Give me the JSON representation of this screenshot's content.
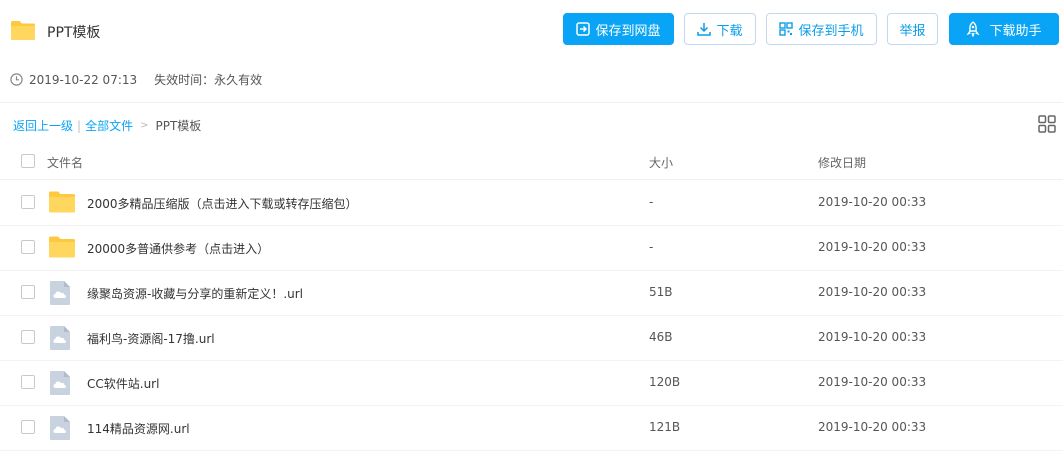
{
  "header": {
    "title": "PPT模板",
    "buttons": {
      "save_to_cloud": "保存到网盘",
      "download": "下载",
      "save_to_phone": "保存到手机",
      "report": "举报",
      "download_helper": "下载助手"
    }
  },
  "meta": {
    "time": "2019-10-22 07:13",
    "expire": "失效时间：永久有效"
  },
  "breadcrumb": {
    "back": "返回上一级",
    "separator": "|",
    "all_files": "全部文件",
    "arrow": ">",
    "current": "PPT模板"
  },
  "table": {
    "headers": {
      "name": "文件名",
      "size": "大小",
      "date": "修改日期"
    },
    "rows": [
      {
        "type": "folder",
        "name": "2000多精品压缩版（点击进入下载或转存压缩包）",
        "size": "-",
        "date": "2019-10-20 00:33"
      },
      {
        "type": "folder",
        "name": "20000多普通供参考（点击进入）",
        "size": "-",
        "date": "2019-10-20 00:33"
      },
      {
        "type": "file",
        "name": "缘聚岛资源-收藏与分享的重新定义！.url",
        "size": "51B",
        "date": "2019-10-20 00:33"
      },
      {
        "type": "file",
        "name": "福利鸟-资源阁-17撸.url",
        "size": "46B",
        "date": "2019-10-20 00:33"
      },
      {
        "type": "file",
        "name": "CC软件站.url",
        "size": "120B",
        "date": "2019-10-20 00:33"
      },
      {
        "type": "file",
        "name": "114精品资源网.url",
        "size": "121B",
        "date": "2019-10-20 00:33"
      }
    ]
  },
  "colors": {
    "accent": "#09a4f5",
    "folder": "#fcc93f",
    "file_icon": "#c9d3df"
  }
}
